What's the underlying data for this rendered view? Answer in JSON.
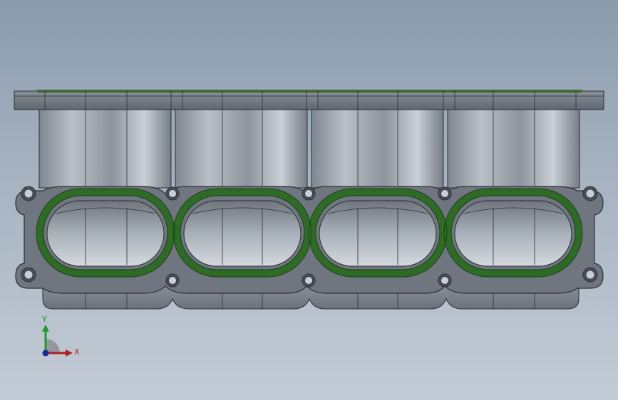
{
  "viewport": {
    "background_top": "#8b9bad",
    "background_bottom": "#c3ccd6"
  },
  "model": {
    "type": "intake-manifold-flange",
    "runner_count": 4,
    "gasket_color": "#2e6b25",
    "body_color": "#7d848d"
  },
  "triad": {
    "x_label": "X",
    "y_label": "Y",
    "x_color": "#b02020",
    "y_color": "#1f9a2a",
    "z_color": "#1a2a9a"
  }
}
